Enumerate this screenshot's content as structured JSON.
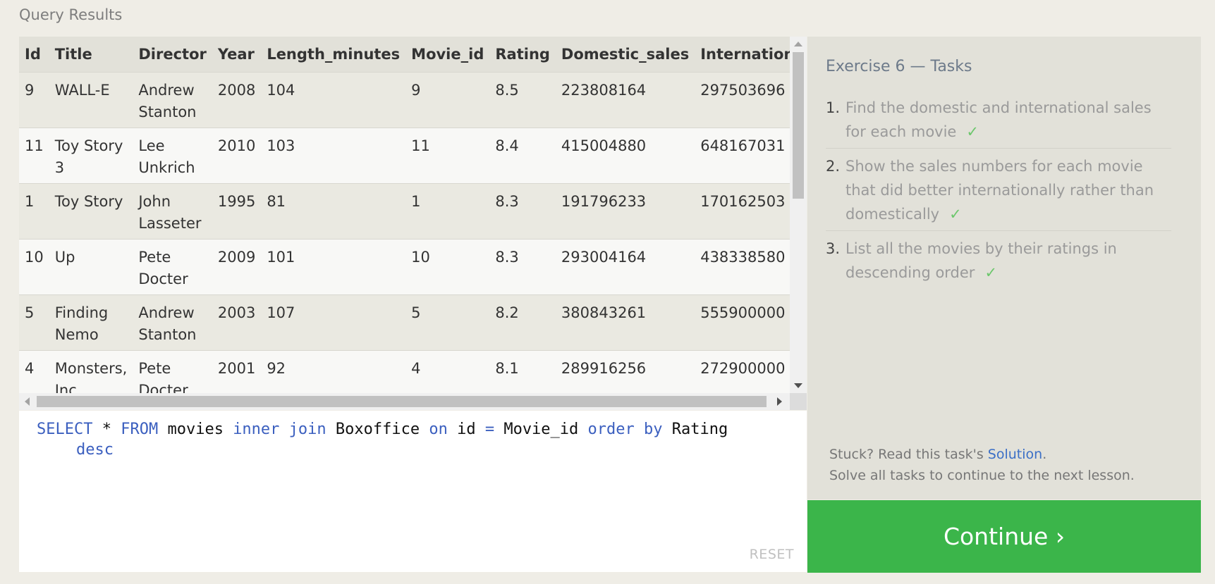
{
  "page_title": "Query Results",
  "table": {
    "columns": [
      "Id",
      "Title",
      "Director",
      "Year",
      "Length_minutes",
      "Movie_id",
      "Rating",
      "Domestic_sales",
      "International_sa"
    ],
    "rows": [
      [
        "9",
        "WALL-E",
        "Andrew Stanton",
        "2008",
        "104",
        "9",
        "8.5",
        "223808164",
        "297503696"
      ],
      [
        "11",
        "Toy Story 3",
        "Lee Unkrich",
        "2010",
        "103",
        "11",
        "8.4",
        "415004880",
        "648167031"
      ],
      [
        "1",
        "Toy Story",
        "John Lasseter",
        "1995",
        "81",
        "1",
        "8.3",
        "191796233",
        "170162503"
      ],
      [
        "10",
        "Up",
        "Pete Docter",
        "2009",
        "101",
        "10",
        "8.3",
        "293004164",
        "438338580"
      ],
      [
        "5",
        "Finding Nemo",
        "Andrew Stanton",
        "2003",
        "107",
        "5",
        "8.2",
        "380843261",
        "555900000"
      ],
      [
        "4",
        "Monsters, Inc.",
        "Pete Docter",
        "2001",
        "92",
        "4",
        "8.1",
        "289916256",
        "272900000"
      ]
    ]
  },
  "editor": {
    "tokens_line1": [
      {
        "t": "SELECT",
        "kw": true
      },
      {
        "t": " * ",
        "kw": false
      },
      {
        "t": "FROM",
        "kw": true
      },
      {
        "t": " movies ",
        "kw": false
      },
      {
        "t": "inner join",
        "kw": true
      },
      {
        "t": " Boxoffice ",
        "kw": false
      },
      {
        "t": "on",
        "kw": true
      },
      {
        "t": " id ",
        "kw": false
      },
      {
        "t": "=",
        "kw": true
      },
      {
        "t": " Movie_id ",
        "kw": false
      },
      {
        "t": "order by",
        "kw": true
      },
      {
        "t": " Rating",
        "kw": false
      }
    ],
    "tokens_line2": [
      {
        "t": "desc",
        "kw": true
      }
    ],
    "reset_label": "RESET"
  },
  "tasks": {
    "title": "Exercise 6 — Tasks",
    "items": [
      {
        "num": "1.",
        "text": "Find the domestic and international sales for each movie",
        "check": "✓"
      },
      {
        "num": "2.",
        "text": "Show the sales numbers for each movie that did better internationally rather than domestically",
        "check": "✓"
      },
      {
        "num": "3.",
        "text": "List all the movies by their ratings in descending order",
        "check": "✓"
      }
    ],
    "stuck_prefix": "Stuck? Read this task's ",
    "solution_link": "Solution",
    "stuck_suffix": ".",
    "solve_all": "Solve all tasks to continue to the next lesson."
  },
  "continue_label": "Continue ›",
  "colors": {
    "accent_green": "#3bb54a",
    "keyword_blue": "#3b5fbf",
    "check_green": "#6cc76c"
  }
}
